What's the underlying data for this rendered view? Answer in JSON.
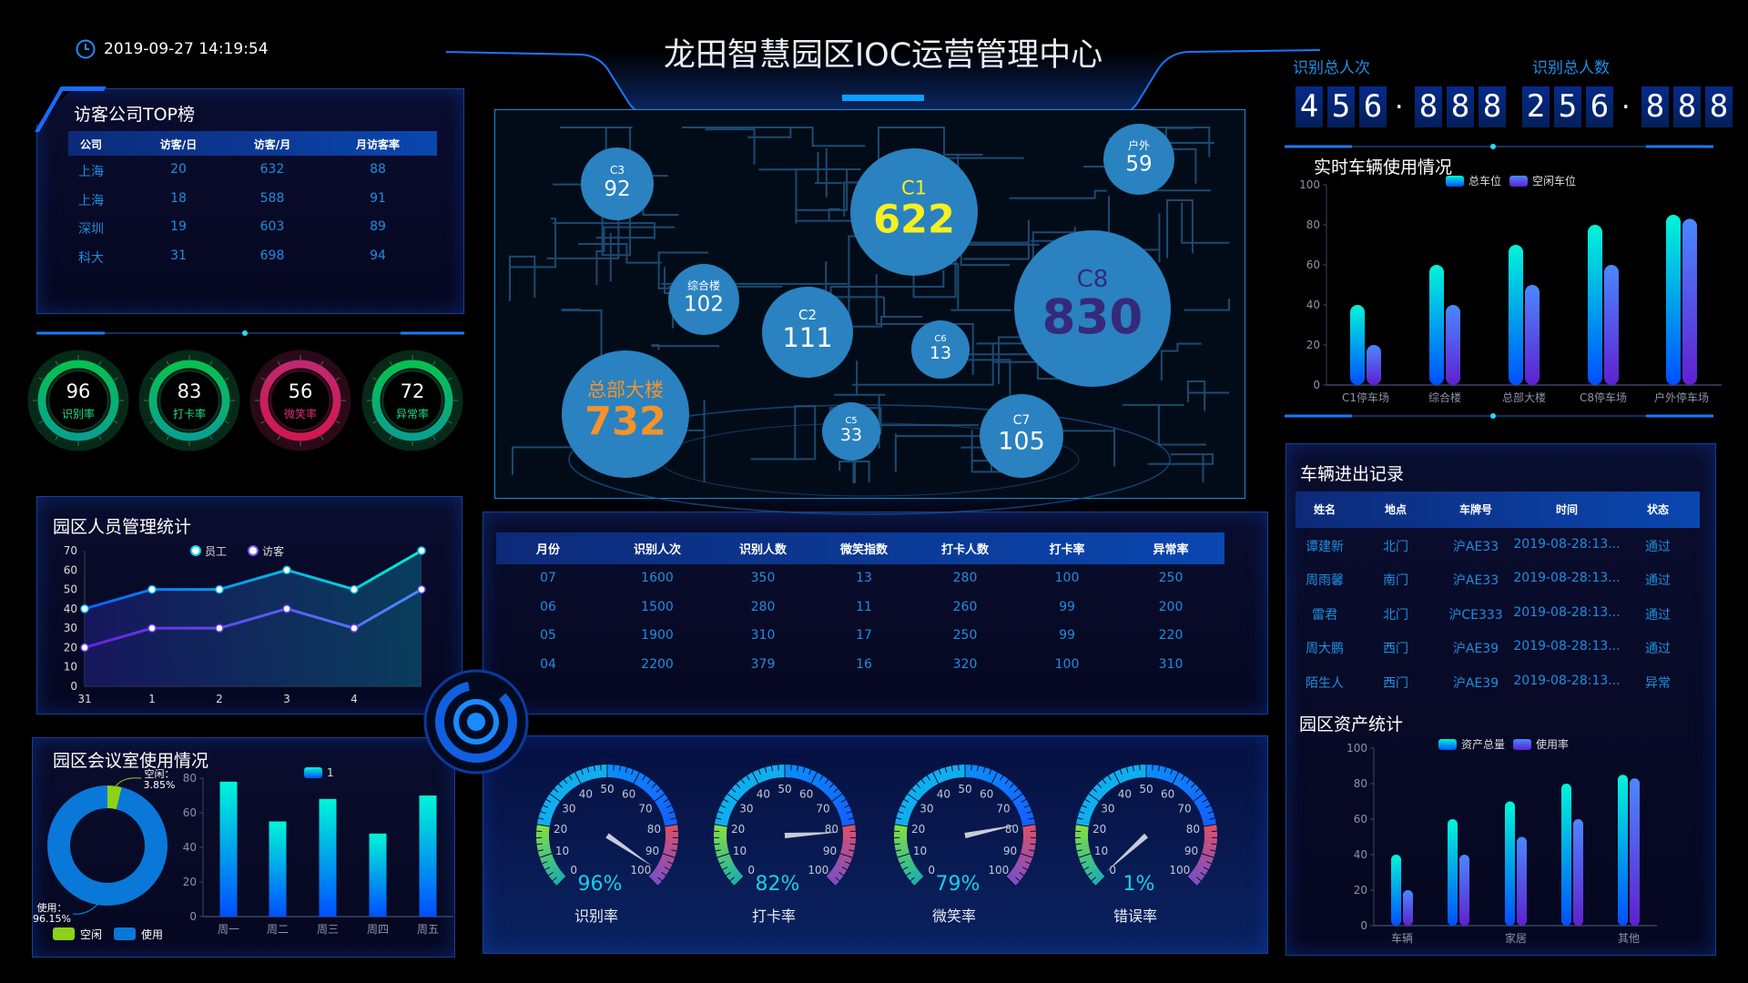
{
  "header": {
    "title": "龙田智慧园区IOC运营管理中心",
    "datetime": "2019-09-27 14:19:54"
  },
  "counters": [
    {
      "label": "识别总人次",
      "digits": [
        "4",
        "5",
        "6",
        ".",
        "8",
        "8",
        "8"
      ]
    },
    {
      "label": "识别总人数",
      "digits": [
        "2",
        "5",
        "6",
        ".",
        "8",
        "8",
        "8"
      ]
    }
  ],
  "visitor_top": {
    "title": "访客公司TOP榜",
    "columns": [
      "公司",
      "访客/日",
      "访客/月",
      "月访客率"
    ],
    "rows": [
      [
        "上海",
        "20",
        "632",
        "88"
      ],
      [
        "上海",
        "18",
        "588",
        "91"
      ],
      [
        "深圳",
        "19",
        "603",
        "89"
      ],
      [
        "科大",
        "31",
        "698",
        "94"
      ]
    ]
  },
  "rings": [
    {
      "value": 96,
      "label": "识别率",
      "color": "#10c070",
      "label_color": "#19e08a"
    },
    {
      "value": 83,
      "label": "打卡率",
      "color": "#10c070",
      "label_color": "#19e08a"
    },
    {
      "value": 56,
      "label": "微笑率",
      "color": "#d0206a",
      "label_color": "#e0307a"
    },
    {
      "value": 72,
      "label": "异常率",
      "color": "#10c070",
      "label_color": "#19e08a"
    }
  ],
  "people_panel": {
    "title": "园区人员管理统计"
  },
  "meeting_panel": {
    "title": "园区会议室使用情况"
  },
  "map": {
    "bubbles": [
      {
        "name": "C3",
        "value": "92",
        "color": "#ffffff"
      },
      {
        "name": "C1",
        "value": "622",
        "color": "#f5f020"
      },
      {
        "name": "户外",
        "value": "59",
        "color": "#ffffff"
      },
      {
        "name": "C8",
        "value": "830",
        "color": "#352a7a"
      },
      {
        "name": "综合楼",
        "value": "102",
        "color": "#ffffff"
      },
      {
        "name": "C2",
        "value": "111",
        "color": "#ffffff"
      },
      {
        "name": "C6",
        "value": "13",
        "color": "#ffffff"
      },
      {
        "name": "总部大楼",
        "value": "732",
        "color": "#f5922a"
      },
      {
        "name": "C5",
        "value": "33",
        "color": "#ffffff"
      },
      {
        "name": "C7",
        "value": "105",
        "color": "#ffffff"
      }
    ]
  },
  "monthly_table": {
    "columns": [
      "月份",
      "识别人次",
      "识别人数",
      "微笑指数",
      "打卡人数",
      "打卡率",
      "异常率"
    ],
    "rows": [
      [
        "07",
        "1600",
        "350",
        "13",
        "280",
        "100",
        "250"
      ],
      [
        "06",
        "1500",
        "280",
        "11",
        "260",
        "99",
        "200"
      ],
      [
        "05",
        "1900",
        "310",
        "17",
        "250",
        "99",
        "220"
      ],
      [
        "04",
        "2200",
        "379",
        "16",
        "320",
        "100",
        "310"
      ]
    ]
  },
  "gauges": [
    {
      "value": 96,
      "text": "96%",
      "label": "识别率"
    },
    {
      "value": 82,
      "text": "82%",
      "label": "打卡率"
    },
    {
      "value": 79,
      "text": "79%",
      "label": "微笑率"
    },
    {
      "value": 1,
      "text": "1%",
      "label": "错误率"
    }
  ],
  "gauge_scale": [
    "0",
    "10",
    "20",
    "30",
    "40",
    "50",
    "60",
    "70",
    "80",
    "90",
    "100"
  ],
  "vehicle_records": {
    "title": "车辆进出记录",
    "columns": [
      "姓名",
      "地点",
      "车牌号",
      "时间",
      "状态"
    ],
    "rows": [
      [
        "谭建新",
        "北门",
        "沪AE33",
        "2019-08-28:13...",
        "通过"
      ],
      [
        "周雨馨",
        "南门",
        "沪AE33",
        "2019-08-28:13...",
        "通过"
      ],
      [
        "雷君",
        "北门",
        "沪CE333",
        "2019-08-28:13...",
        "通过"
      ],
      [
        "周大鹏",
        "西门",
        "沪AE39",
        "2019-08-28:13...",
        "通过"
      ],
      [
        "陌生人",
        "西门",
        "沪AE39",
        "2019-08-28:13...",
        "异常"
      ]
    ]
  },
  "chart_data": [
    {
      "id": "people",
      "type": "line",
      "title": "园区人员管理统计",
      "categories": [
        "31",
        "1",
        "2",
        "3",
        "4",
        ""
      ],
      "series": [
        {
          "name": "员工",
          "values": [
            40,
            50,
            50,
            60,
            50,
            70
          ]
        },
        {
          "name": "访客",
          "values": [
            20,
            30,
            30,
            40,
            30,
            50
          ]
        }
      ],
      "yticks": [
        "0",
        "10",
        "20",
        "30",
        "40",
        "50",
        "60",
        "70"
      ],
      "ylim": [
        0,
        70
      ],
      "legend": "top-center"
    },
    {
      "id": "meeting_donut",
      "type": "pie",
      "slices": [
        {
          "name": "空闲",
          "value": 3.85,
          "label": "空闲：",
          "pct": "3.85%",
          "color": "#8ed11a"
        },
        {
          "name": "使用",
          "value": 96.15,
          "label": "使用：",
          "pct": "96.15%",
          "color": "#0a78d8"
        }
      ],
      "legend": "bottom"
    },
    {
      "id": "meeting_bar",
      "type": "bar",
      "categories": [
        "周一",
        "周二",
        "周三",
        "周四",
        "周五"
      ],
      "series": [
        {
          "name": "1",
          "values": [
            78,
            55,
            68,
            48,
            70
          ]
        }
      ],
      "yticks": [
        "0",
        "20",
        "40",
        "60",
        "80"
      ],
      "ylim": [
        0,
        80
      ],
      "legend": "top"
    },
    {
      "id": "vehicle_usage",
      "type": "bar",
      "title": "实时车辆使用情况",
      "categories": [
        "C1停车场",
        "综合楼",
        "总部大楼",
        "C8停车场",
        "户外停车场"
      ],
      "series": [
        {
          "name": "总车位",
          "values": [
            40,
            60,
            70,
            80,
            85
          ]
        },
        {
          "name": "空闲车位",
          "values": [
            20,
            40,
            50,
            60,
            83
          ]
        }
      ],
      "yticks": [
        "0",
        "20",
        "40",
        "60",
        "80",
        "100"
      ],
      "ylim": [
        0,
        100
      ],
      "legend": "top"
    },
    {
      "id": "assets",
      "type": "bar",
      "title": "园区资产统计",
      "categories": [
        "车辆",
        "",
        "家居",
        "",
        "其他"
      ],
      "series": [
        {
          "name": "资产总量",
          "values": [
            40,
            60,
            70,
            80,
            85
          ]
        },
        {
          "name": "使用率",
          "values": [
            20,
            40,
            50,
            60,
            83
          ]
        }
      ],
      "yticks": [
        "0",
        "20",
        "40",
        "60",
        "80",
        "100"
      ],
      "ylim": [
        0,
        100
      ],
      "legend": "top"
    }
  ]
}
